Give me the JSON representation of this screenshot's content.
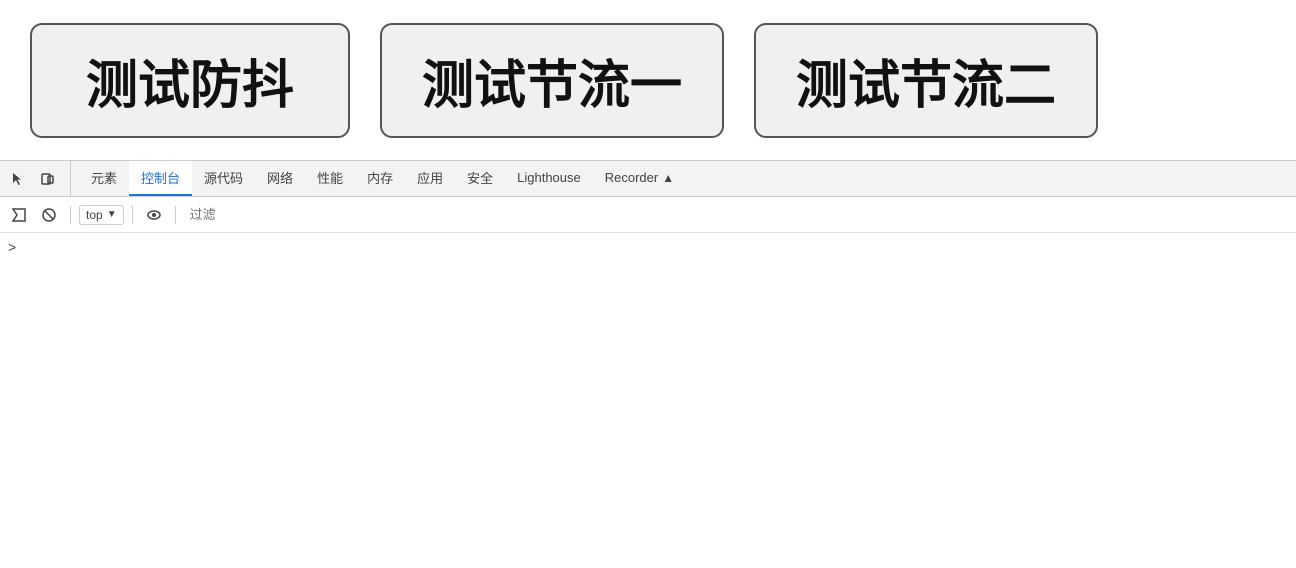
{
  "buttons": [
    {
      "label": "测试防抖",
      "id": "btn-debounce"
    },
    {
      "label": "测试节流一",
      "id": "btn-throttle1"
    },
    {
      "label": "测试节流二",
      "id": "btn-throttle2"
    }
  ],
  "devtools": {
    "tabs": [
      {
        "label": "元素",
        "id": "elements",
        "active": false
      },
      {
        "label": "控制台",
        "id": "console",
        "active": true
      },
      {
        "label": "源代码",
        "id": "sources",
        "active": false
      },
      {
        "label": "网络",
        "id": "network",
        "active": false
      },
      {
        "label": "性能",
        "id": "performance",
        "active": false
      },
      {
        "label": "内存",
        "id": "memory",
        "active": false
      },
      {
        "label": "应用",
        "id": "application",
        "active": false
      },
      {
        "label": "安全",
        "id": "security",
        "active": false
      },
      {
        "label": "Lighthouse",
        "id": "lighthouse",
        "active": false
      },
      {
        "label": "Recorder",
        "id": "recorder",
        "active": false
      }
    ],
    "console": {
      "context": "top",
      "filter_placeholder": "过滤",
      "content_arrow": ">"
    }
  }
}
